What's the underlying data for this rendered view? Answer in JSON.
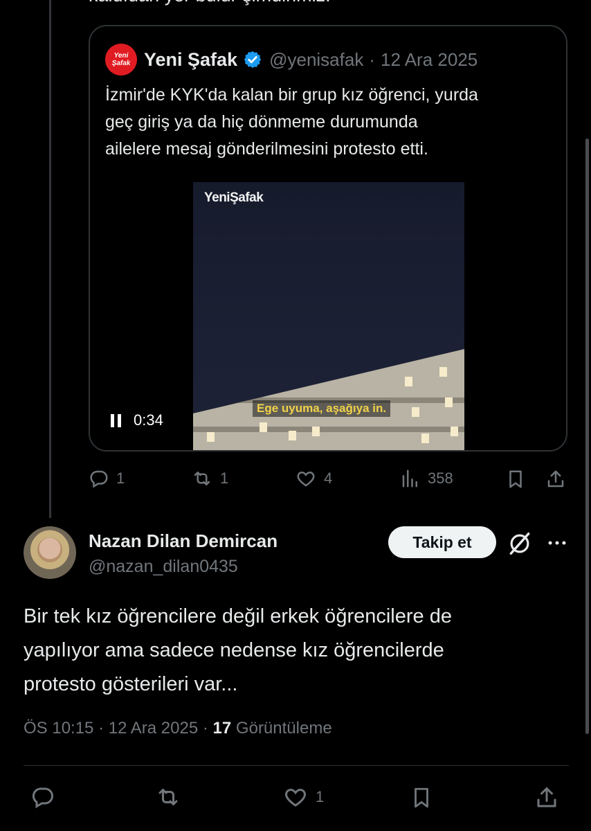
{
  "top_clipped_text": "kaldıdan yer bulur şimdirimiz.",
  "quoted_post": {
    "author_name": "Yeni Şafak",
    "logo_line1": "Yeni",
    "logo_line2": "Şafak",
    "handle": "@yenisafak",
    "separator": "·",
    "date": "12 Ara 2025",
    "text_lines": [
      "İzmir'de KYK'da kalan bir grup kız öğrenci, yurda",
      "geç giriş ya da  hiç dönmeme durumunda",
      "ailelere mesaj gönderilmesini protesto etti."
    ],
    "video": {
      "watermark": "YeniŞafak",
      "subtitle": "Ege uyuma, aşağıya in.",
      "time": "0:34",
      "state": "playing"
    }
  },
  "quoted_actions": {
    "replies": "1",
    "reposts": "1",
    "likes": "4",
    "views": "358"
  },
  "reply_post": {
    "author_name": "Nazan Dilan Demircan",
    "handle": "@nazan_dilan0435",
    "follow_label": "Takip et",
    "text_lines": [
      "Bir tek kız öğrencilere değil erkek öğrencilere de",
      "yapılıyor ama sadece nedense kız öğrencilerde",
      "protesto gösterileri var..."
    ],
    "time": "ÖS 10:15",
    "separator": "·",
    "date": "12 Ara 2025",
    "views_count": "17",
    "views_label": "Görüntüleme"
  },
  "reply_actions": {
    "likes": "1"
  },
  "icons": [
    "reply-icon",
    "repost-icon",
    "like-icon",
    "views-icon",
    "bookmark-icon",
    "share-icon",
    "grok-icon",
    "more-icon",
    "verified-icon",
    "pause-icon"
  ],
  "colors": {
    "background": "#000000",
    "text": "#e7e9ea",
    "muted": "#71767b",
    "border": "#2f3336",
    "verified": "#1d9bf0",
    "brand_logo": "#e11b22",
    "subtitle": "#f1d24a"
  }
}
